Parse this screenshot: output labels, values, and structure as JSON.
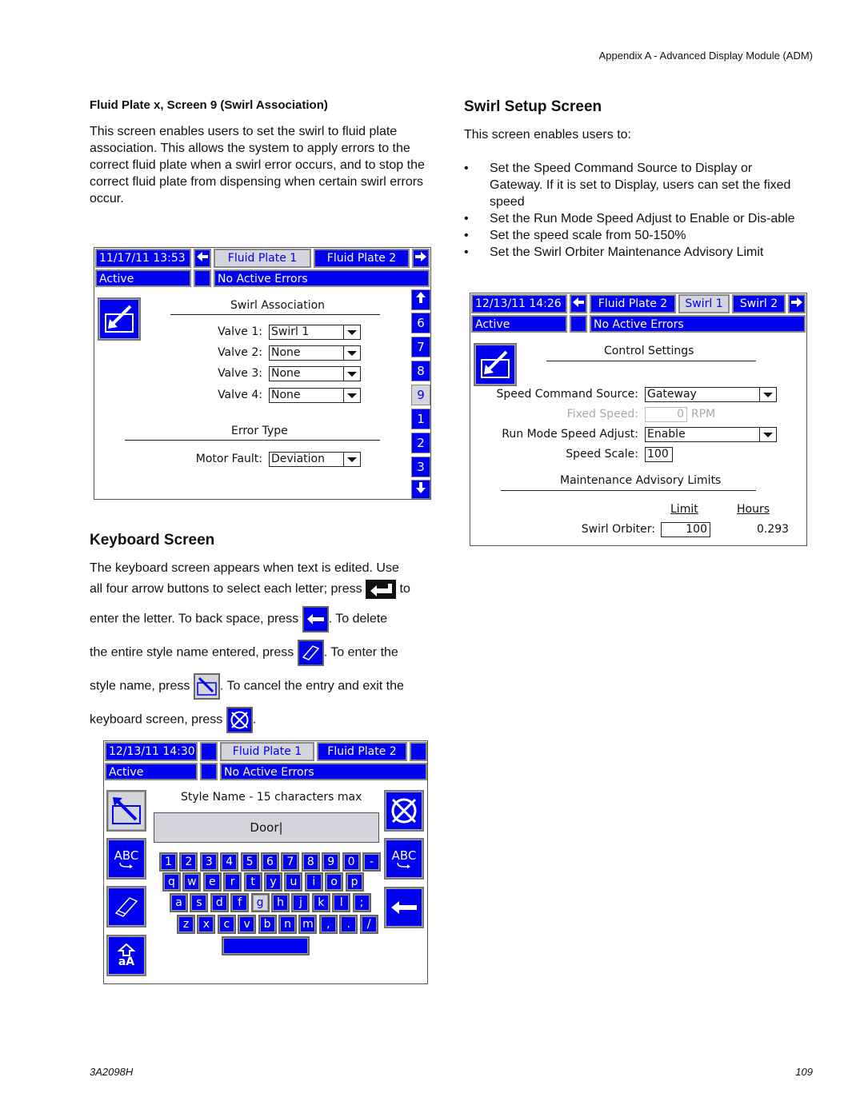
{
  "page": {
    "header": "Appendix A - Advanced Display Module (ADM)",
    "footer_left": "3A2098H",
    "footer_right": "109"
  },
  "swirl_assoc": {
    "heading": "Fluid Plate x, Screen 9 (Swirl Association)",
    "body": "This screen enables users to set the swirl to fluid plate association. This allows the system to apply errors to the correct fluid plate when a swirl error occurs, and to stop the correct fluid plate from dispensing when certain swirl errors occur.",
    "screen": {
      "datetime": "11/17/11 13:53",
      "tabs": [
        "Fluid Plate 1",
        "Fluid Plate 2"
      ],
      "selected_tab": "Fluid Plate 1",
      "status": "Active",
      "errors": "No Active Errors",
      "section1": "Swirl Association",
      "valves": [
        {
          "label": "Valve 1:",
          "value": "Swirl 1"
        },
        {
          "label": "Valve 2:",
          "value": "None"
        },
        {
          "label": "Valve 3:",
          "value": "None"
        },
        {
          "label": "Valve 4:",
          "value": "None"
        }
      ],
      "section2": "Error Type",
      "motor_fault_label": "Motor Fault:",
      "motor_fault_value": "Deviation",
      "side_pages": [
        "6",
        "7",
        "8",
        "9",
        "1",
        "2",
        "3"
      ],
      "selected_page": "9"
    }
  },
  "keyboard": {
    "heading": "Keyboard Screen",
    "text": {
      "l1": "The keyboard screen appears when text is edited. Use",
      "l2a": "all four arrow buttons to select each letter; press",
      "l2b": "to",
      "l3a": "enter the letter. To back space, press",
      "l3b": ". To delete",
      "l4a": "the entire style name entered, press",
      "l4b": ". To enter the",
      "l5a": "style name, press",
      "l5b": ". To cancel the entry and exit the",
      "l6a": "keyboard screen, press",
      "l6b": "."
    },
    "screen": {
      "datetime": "12/13/11 14:30",
      "tabs": [
        "Fluid Plate 1",
        "Fluid Plate 2"
      ],
      "selected_tab": "Fluid Plate 1",
      "status": "Active",
      "errors": "No Active Errors",
      "title": "Style Name - 15 characters max",
      "entry": "Door|",
      "abc_label": "ABC",
      "shift_label": "aA",
      "rows": [
        [
          "1",
          "2",
          "3",
          "4",
          "5",
          "6",
          "7",
          "8",
          "9",
          "0",
          "-"
        ],
        [
          "q",
          "w",
          "e",
          "r",
          "t",
          "y",
          "u",
          "i",
          "o",
          "p"
        ],
        [
          "a",
          "s",
          "d",
          "f",
          "g",
          "h",
          "j",
          "k",
          "l",
          ";"
        ],
        [
          "z",
          "x",
          "c",
          "v",
          "b",
          "n",
          "m",
          ",",
          ".",
          "/"
        ]
      ],
      "selected_key": "g"
    }
  },
  "swirl_setup": {
    "heading": "Swirl Setup Screen",
    "intro": "This screen enables users to:",
    "bullets": [
      "Set the Speed Command Source to Display or Gateway. If it is set to Display, users can set the fixed speed",
      "Set the Run Mode Speed Adjust to Enable or Dis-able",
      "Set the speed scale from 50-150%",
      "Set the Swirl Orbiter Maintenance Advisory Limit"
    ],
    "screen": {
      "datetime": "12/13/11 14:26",
      "tabs": [
        "Fluid Plate 2",
        "Swirl 1",
        "Swirl 2"
      ],
      "selected_tab": "Swirl 1",
      "status": "Active",
      "errors": "No Active Errors",
      "section1": "Control Settings",
      "speed_cmd_label": "Speed Command Source:",
      "speed_cmd_value": "Gateway",
      "fixed_speed_label": "Fixed Speed:",
      "fixed_speed_value": "0",
      "fixed_speed_unit": "RPM",
      "run_mode_label": "Run Mode Speed Adjust:",
      "run_mode_value": "Enable",
      "speed_scale_label": "Speed Scale:",
      "speed_scale_value": "100",
      "section2": "Maintenance Advisory Limits",
      "col_limit": "Limit",
      "col_hours": "Hours",
      "orbiter_label": "Swirl Orbiter:",
      "orbiter_limit": "100",
      "orbiter_hours": "0.293"
    }
  },
  "colors": {
    "adm_blue": "#0000f0",
    "adm_selected": "#d4d4dc",
    "disabled_text": "#a8a8a8"
  }
}
